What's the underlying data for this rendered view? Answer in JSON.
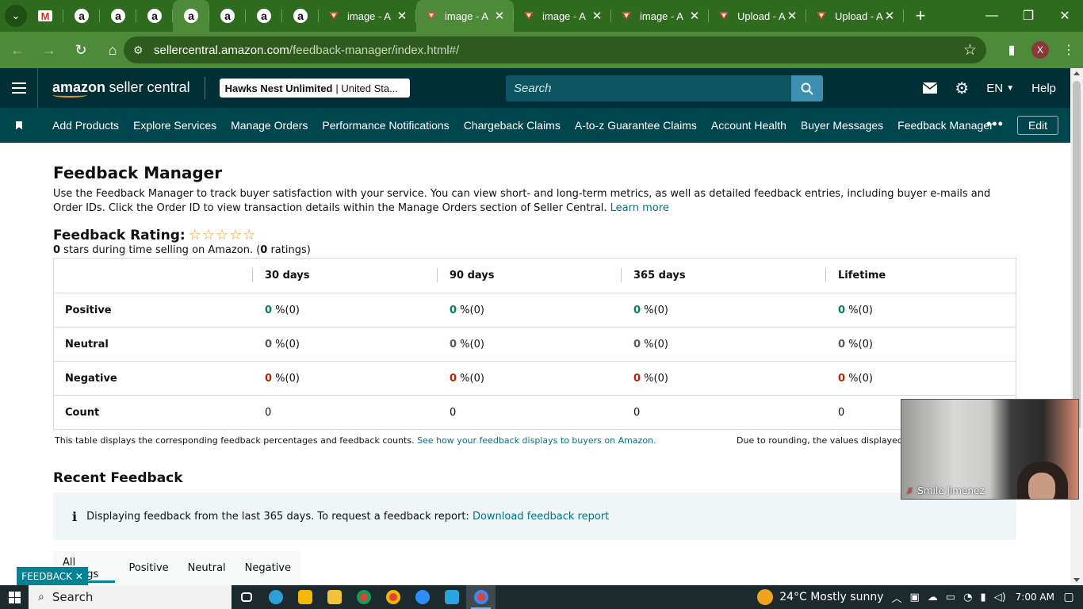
{
  "browser": {
    "tabs": [
      {
        "title": "image - A",
        "icon": "amazon-red-icon",
        "active": false
      },
      {
        "title": "image - A",
        "icon": "amazon-red-icon",
        "active": true
      },
      {
        "title": "image - A",
        "icon": "amazon-red-icon",
        "active": false
      },
      {
        "title": "image - A",
        "icon": "amazon-red-icon",
        "active": false
      },
      {
        "title": "Upload - A",
        "icon": "amazon-red-icon",
        "active": false
      },
      {
        "title": "Upload - A",
        "icon": "amazon-red-icon",
        "active": false
      }
    ],
    "pinned_gmail": "M",
    "pinned_amazon": "a",
    "url_domain": "sellercentral.amazon.com",
    "url_path": "/feedback-manager/index.html#/",
    "profile_initial": "X"
  },
  "header": {
    "logo_brand": "amazon",
    "logo_suffix": "seller central",
    "account_name": "Hawks Nest Unlimited",
    "account_region": "| United Sta...",
    "search_placeholder": "Search",
    "language": "EN",
    "help": "Help"
  },
  "nav": {
    "items": [
      "Add Products",
      "Explore Services",
      "Manage Orders",
      "Performance Notifications",
      "Chargeback Claims",
      "A-to-z Guarantee Claims",
      "Account Health",
      "Buyer Messages",
      "Feedback Manager"
    ],
    "more": "•••",
    "edit": "Edit"
  },
  "main": {
    "title": "Feedback Manager",
    "intro": "Use the Feedback Manager to track buyer satisfaction with your service. You can view short- and long-term metrics, as well as detailed feedback entries, including buyer e-mails and Order IDs. Click the Order ID to view transaction details within the Manage Orders section of Seller Central.",
    "learn_more": "Learn more",
    "rating_label": "Feedback Rating:",
    "stars": "☆☆☆☆☆",
    "rating_value": 0,
    "rating_sub_a": "0",
    "rating_sub_b": " stars during time selling on Amazon. (",
    "rating_sub_c": "0",
    "rating_sub_d": " ratings)",
    "table": {
      "headers": [
        "",
        "30 days",
        "90 days",
        "365 days",
        "Lifetime"
      ],
      "rows": [
        {
          "label": "Positive",
          "cells": [
            {
              "n": "0",
              "p": " %(0)"
            },
            {
              "n": "0",
              "p": " %(0)"
            },
            {
              "n": "0",
              "p": " %(0)"
            },
            {
              "n": "0",
              "p": " %(0)"
            }
          ]
        },
        {
          "label": "Neutral",
          "cells": [
            {
              "n": "0",
              "p": " %(0)"
            },
            {
              "n": "0",
              "p": " %(0)"
            },
            {
              "n": "0",
              "p": " %(0)"
            },
            {
              "n": "0",
              "p": " %(0)"
            }
          ]
        },
        {
          "label": "Negative",
          "cells": [
            {
              "n": "0",
              "p": " %(0)"
            },
            {
              "n": "0",
              "p": " %(0)"
            },
            {
              "n": "0",
              "p": " %(0)"
            },
            {
              "n": "0",
              "p": " %(0)"
            }
          ]
        },
        {
          "label": "Count",
          "cells": [
            "0",
            "0",
            "0",
            "0"
          ]
        }
      ]
    },
    "footnote": "This table displays the corresponding feedback percentages and feedback counts.",
    "footnote_link": "See how your feedback displays to buyers on Amazon.",
    "footnote_right": "Due to rounding, the values displayed",
    "recent_title": "Recent Feedback",
    "info_icon": "i",
    "info_text": "Displaying feedback from the last 365 days. To request a feedback report:",
    "info_link": "Download feedback report",
    "rating_tabs": [
      "All ratings",
      "Positive",
      "Neutral",
      "Negative"
    ],
    "feedback_pill": "FEEDBACK ✕"
  },
  "video": {
    "name": "Smile Jimenez"
  },
  "taskbar": {
    "search": "Search",
    "weather": "24°C  Mostly sunny",
    "time": "7:00 AM"
  },
  "colors": {
    "header_bg": "#002f36",
    "nav_bg": "#00464f",
    "browser_bg": "#4d8a39",
    "link": "#007185",
    "positive": "#067d62",
    "negative": "#b12704"
  }
}
